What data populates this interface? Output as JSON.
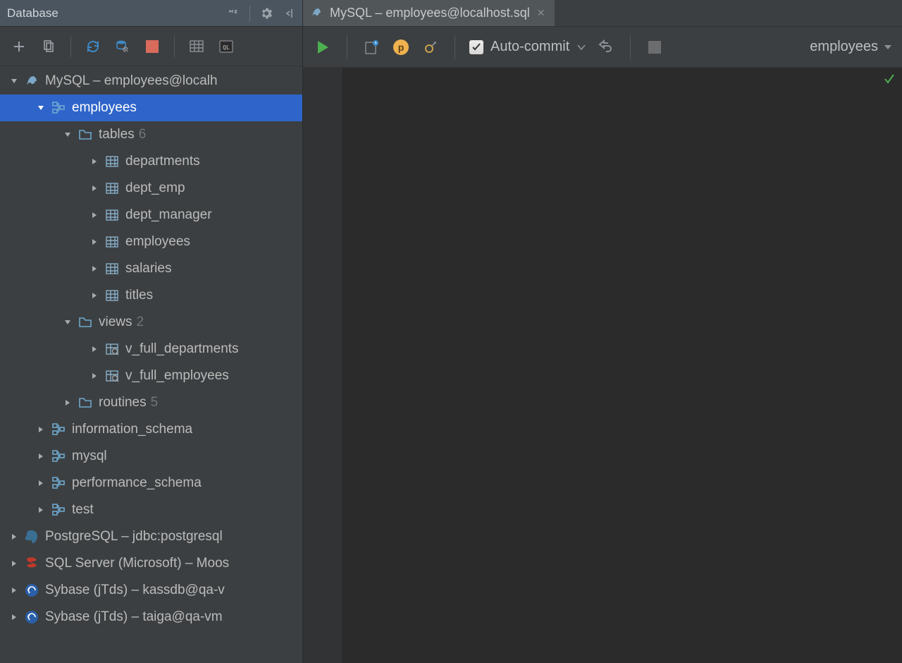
{
  "panel": {
    "title": "Database"
  },
  "editor_tab": {
    "label": "MySQL – employees@localhost.sql"
  },
  "editor_toolbar": {
    "auto_commit": "Auto-commit",
    "schema": "employees"
  },
  "tree": {
    "connections": [
      {
        "label": "MySQL – employees@localh",
        "icon": "mysql",
        "expanded": true,
        "schemas": [
          {
            "label": "employees",
            "selected": true,
            "expanded": true,
            "groups": [
              {
                "label": "tables",
                "count": "6",
                "expanded": true,
                "items": [
                  {
                    "label": "departments",
                    "icon": "table"
                  },
                  {
                    "label": "dept_emp",
                    "icon": "table"
                  },
                  {
                    "label": "dept_manager",
                    "icon": "table"
                  },
                  {
                    "label": "employees",
                    "icon": "table"
                  },
                  {
                    "label": "salaries",
                    "icon": "table"
                  },
                  {
                    "label": "titles",
                    "icon": "table"
                  }
                ]
              },
              {
                "label": "views",
                "count": "2",
                "expanded": true,
                "items": [
                  {
                    "label": "v_full_departments",
                    "icon": "view"
                  },
                  {
                    "label": "v_full_employees",
                    "icon": "view"
                  }
                ]
              },
              {
                "label": "routines",
                "count": "5",
                "expanded": false
              }
            ]
          },
          {
            "label": "information_schema",
            "expanded": false
          },
          {
            "label": "mysql",
            "expanded": false
          },
          {
            "label": "performance_schema",
            "expanded": false
          },
          {
            "label": "test",
            "expanded": false
          }
        ]
      },
      {
        "label": "PostgreSQL – jdbc:postgresql",
        "icon": "postgres",
        "expanded": false
      },
      {
        "label": "SQL Server (Microsoft) – Moos",
        "icon": "sqlserver",
        "expanded": false
      },
      {
        "label": "Sybase (jTds) – kassdb@qa-v",
        "icon": "sybase",
        "expanded": false
      },
      {
        "label": "Sybase (jTds) – taiga@qa-vm",
        "icon": "sybase",
        "expanded": false
      }
    ]
  }
}
